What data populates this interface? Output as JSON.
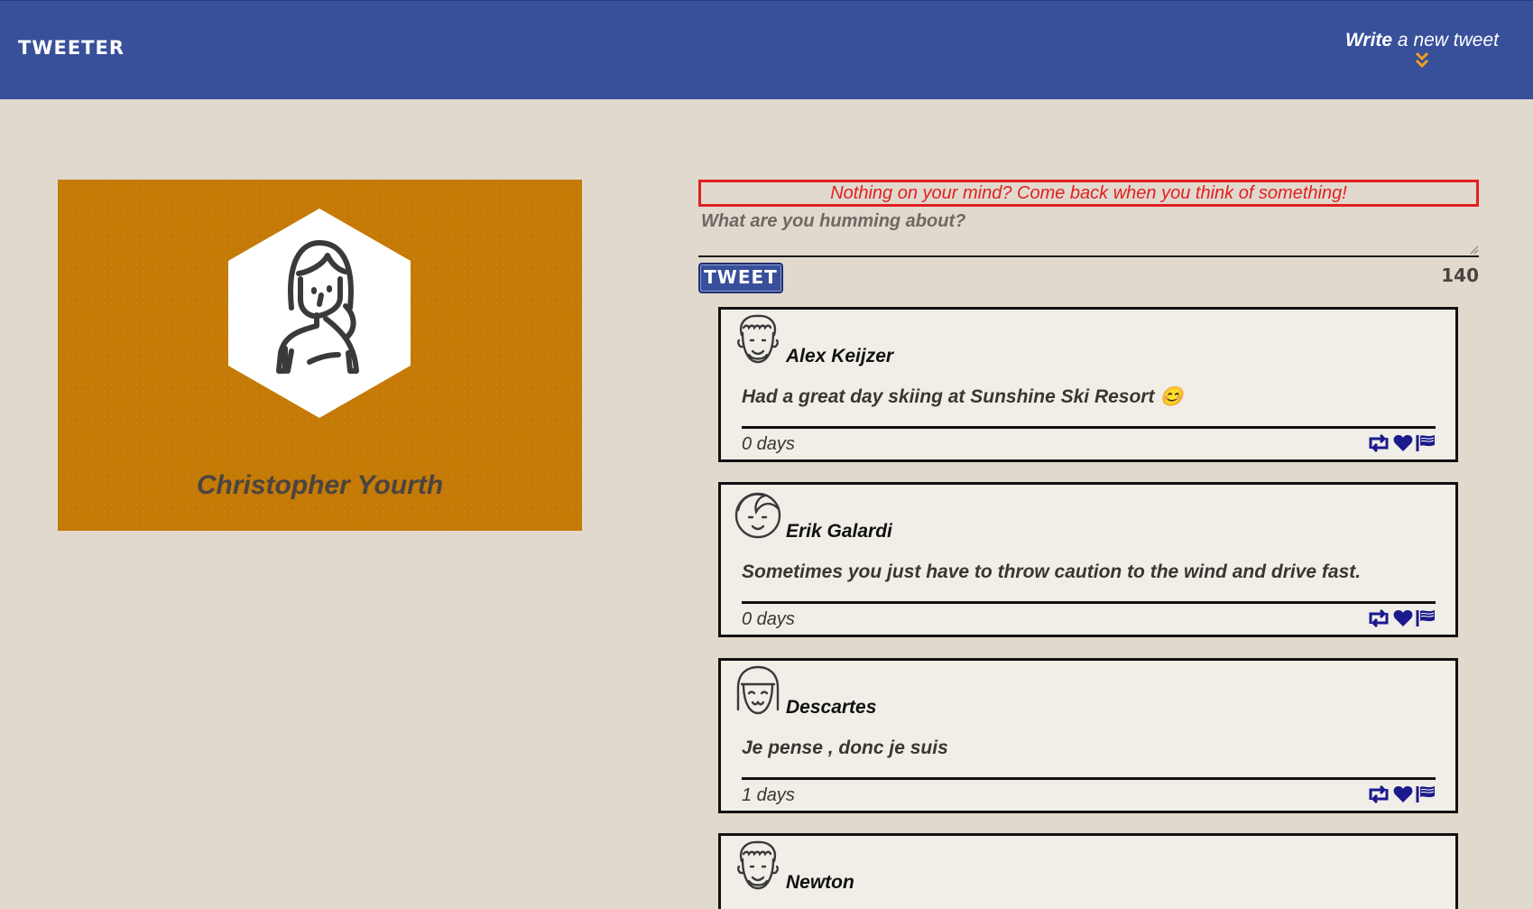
{
  "nav": {
    "brand": "TWEETER",
    "compose_bold": "Write",
    "compose_rest": " a new tweet"
  },
  "profile": {
    "name": "Christopher Yourth"
  },
  "compose": {
    "error": "Nothing on your mind? Come back when you think of something!",
    "placeholder": "What are you humming about?",
    "button": "TWEET",
    "counter": "140"
  },
  "tweets": [
    {
      "author": "Alex Keijzer",
      "content": "Had a great day skiing at Sunshine Ski Resort 😊",
      "age": "0 days"
    },
    {
      "author": "Erik Galardi",
      "content": "Sometimes you just have to throw caution to the wind and drive fast.",
      "age": "0 days"
    },
    {
      "author": "Descartes",
      "content": "Je pense , donc je suis",
      "age": "1 days"
    },
    {
      "author": "Newton",
      "content": "",
      "age": ""
    }
  ],
  "colors": {
    "navbar": "#384f9a",
    "background": "#e2d9ce",
    "profile": "#c47a05",
    "error": "#e02020",
    "accent": "#f0a020",
    "icons": "#1a1a8c"
  }
}
